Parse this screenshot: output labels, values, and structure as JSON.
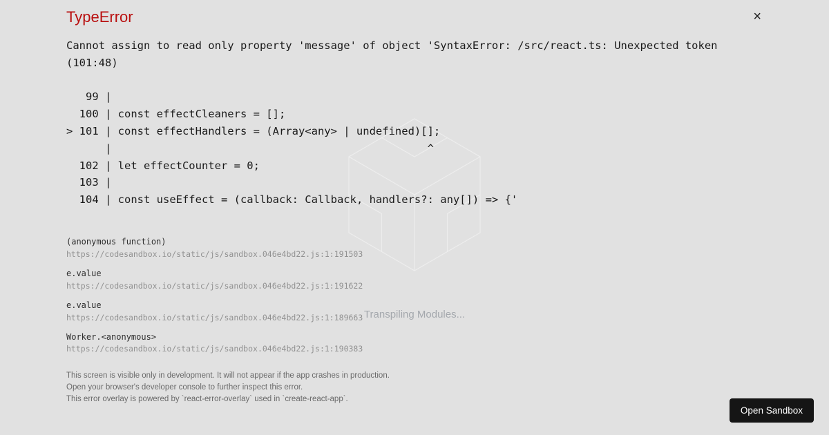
{
  "background": {
    "loading_text": "Transpiling Modules..."
  },
  "error": {
    "type": "TypeError",
    "close_glyph": "×",
    "message": "Cannot assign to read only property 'message' of object 'SyntaxError: /src/react.ts: Unexpected token (101:48)\n\n   99 |\n  100 | const effectCleaners = [];\n> 101 | const effectHandlers = (Array<any> | undefined)[];\n      |                                                 ^\n  102 | let effectCounter = 0;\n  103 |\n  104 | const useEffect = (callback: Callback, handlers?: any[]) => {'",
    "stack": [
      {
        "func": "(anonymous function)",
        "loc": "https://codesandbox.io/static/js/sandbox.046e4bd22.js:1:191503"
      },
      {
        "func": "e.value",
        "loc": "https://codesandbox.io/static/js/sandbox.046e4bd22.js:1:191622"
      },
      {
        "func": "e.value",
        "loc": "https://codesandbox.io/static/js/sandbox.046e4bd22.js:1:189663"
      },
      {
        "func": "Worker.<anonymous>",
        "loc": "https://codesandbox.io/static/js/sandbox.046e4bd22.js:1:190383"
      }
    ],
    "footer": {
      "line1": "This screen is visible only in development. It will not appear if the app crashes in production.",
      "line2": "Open your browser's developer console to further inspect this error.",
      "line3": "This error overlay is powered by `react-error-overlay` used in `create-react-app`."
    }
  },
  "actions": {
    "open_sandbox_label": "Open Sandbox"
  }
}
